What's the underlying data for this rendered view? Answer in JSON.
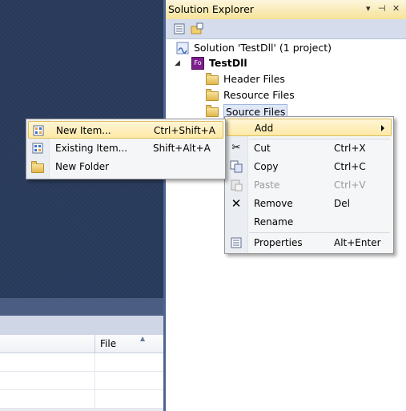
{
  "solution_explorer": {
    "title": "Solution Explorer",
    "title_controls": [
      "▾",
      "⊣",
      "✕"
    ],
    "tree": {
      "solution": "Solution 'TestDll' (1 project)",
      "project": "TestDll",
      "project_icon_text": "Fo",
      "folders": [
        "Header Files",
        "Resource Files",
        "Source Files"
      ]
    }
  },
  "context_menu": {
    "items": [
      {
        "label": "Add",
        "shortcut": "",
        "icon": "none",
        "submenu": true
      },
      {
        "label": "Cut",
        "shortcut": "Ctrl+X",
        "icon": "scissors-icon"
      },
      {
        "label": "Copy",
        "shortcut": "Ctrl+C",
        "icon": "copy-icon"
      },
      {
        "label": "Paste",
        "shortcut": "Ctrl+V",
        "icon": "paste-icon",
        "disabled": true
      },
      {
        "label": "Remove",
        "shortcut": "Del",
        "icon": "remove-icon"
      },
      {
        "label": "Rename",
        "shortcut": "",
        "icon": "none"
      },
      {
        "label": "Properties",
        "shortcut": "Alt+Enter",
        "icon": "properties-icon"
      }
    ]
  },
  "add_submenu": {
    "items": [
      {
        "label": "New Item...",
        "shortcut": "Ctrl+Shift+A",
        "icon": "new-item-icon"
      },
      {
        "label": "Existing Item...",
        "shortcut": "Shift+Alt+A",
        "icon": "existing-item-icon"
      },
      {
        "label": "New Folder",
        "shortcut": "",
        "icon": "new-folder-icon"
      }
    ]
  },
  "bottom_grid": {
    "columns": [
      "File"
    ]
  },
  "colors": {
    "editor_background": "#2b3c59",
    "title_bar": "#f6e39a",
    "highlight": "#fde9a6"
  }
}
